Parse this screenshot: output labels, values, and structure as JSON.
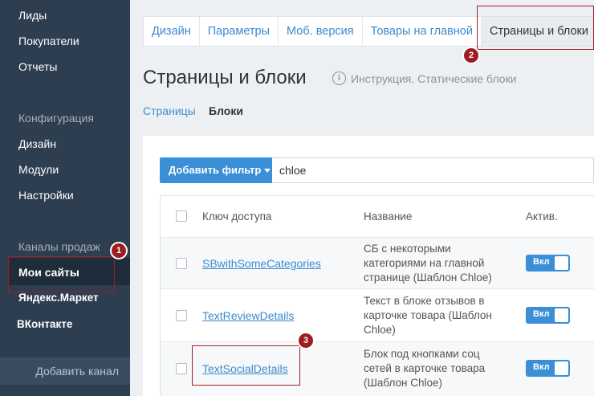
{
  "sidebar": {
    "items_top": [
      "Лиды",
      "Покупатели",
      "Отчеты"
    ],
    "config_section": "Конфигурация",
    "config_items": [
      "Дизайн",
      "Модули",
      "Настройки"
    ],
    "channels_section": "Каналы продаж",
    "channel_items": [
      "Мои сайты",
      "Яндекс.Маркет",
      "ВКонтакте"
    ],
    "add_channel": "Добавить канал"
  },
  "tabs": [
    "Дизайн",
    "Параметры",
    "Моб. версия",
    "Товары на главной",
    "Страницы и блоки"
  ],
  "page": {
    "title": "Страницы и блоки",
    "instruction": "Инструкция. Статические блоки",
    "sublinks": [
      "Страницы",
      "Блоки"
    ]
  },
  "filter": {
    "button_label": "Добавить фильтр",
    "value": "chloe"
  },
  "table": {
    "headers": [
      "Ключ доступа",
      "Название",
      "Актив."
    ],
    "rows": [
      {
        "key": "SBwithSomeCategories",
        "name": "СБ с некоторыми категориями на главной странице (Шаблон Chloe)",
        "active": "Вкл"
      },
      {
        "key": "TextReviewDetails",
        "name": "Текст в блоке отзывов в карточке товара (Шаблон Chloe)",
        "active": "Вкл"
      },
      {
        "key": "TextSocialDetails",
        "name": "Блок под кнопками соц сетей в карточке товара (Шаблон Chloe)",
        "active": "Вкл"
      }
    ]
  },
  "annotations": [
    "1",
    "2",
    "3"
  ],
  "colors": {
    "sidebar_bg": "#2c3e50",
    "accent": "#3a8fd6",
    "annotation": "#a31d24"
  }
}
